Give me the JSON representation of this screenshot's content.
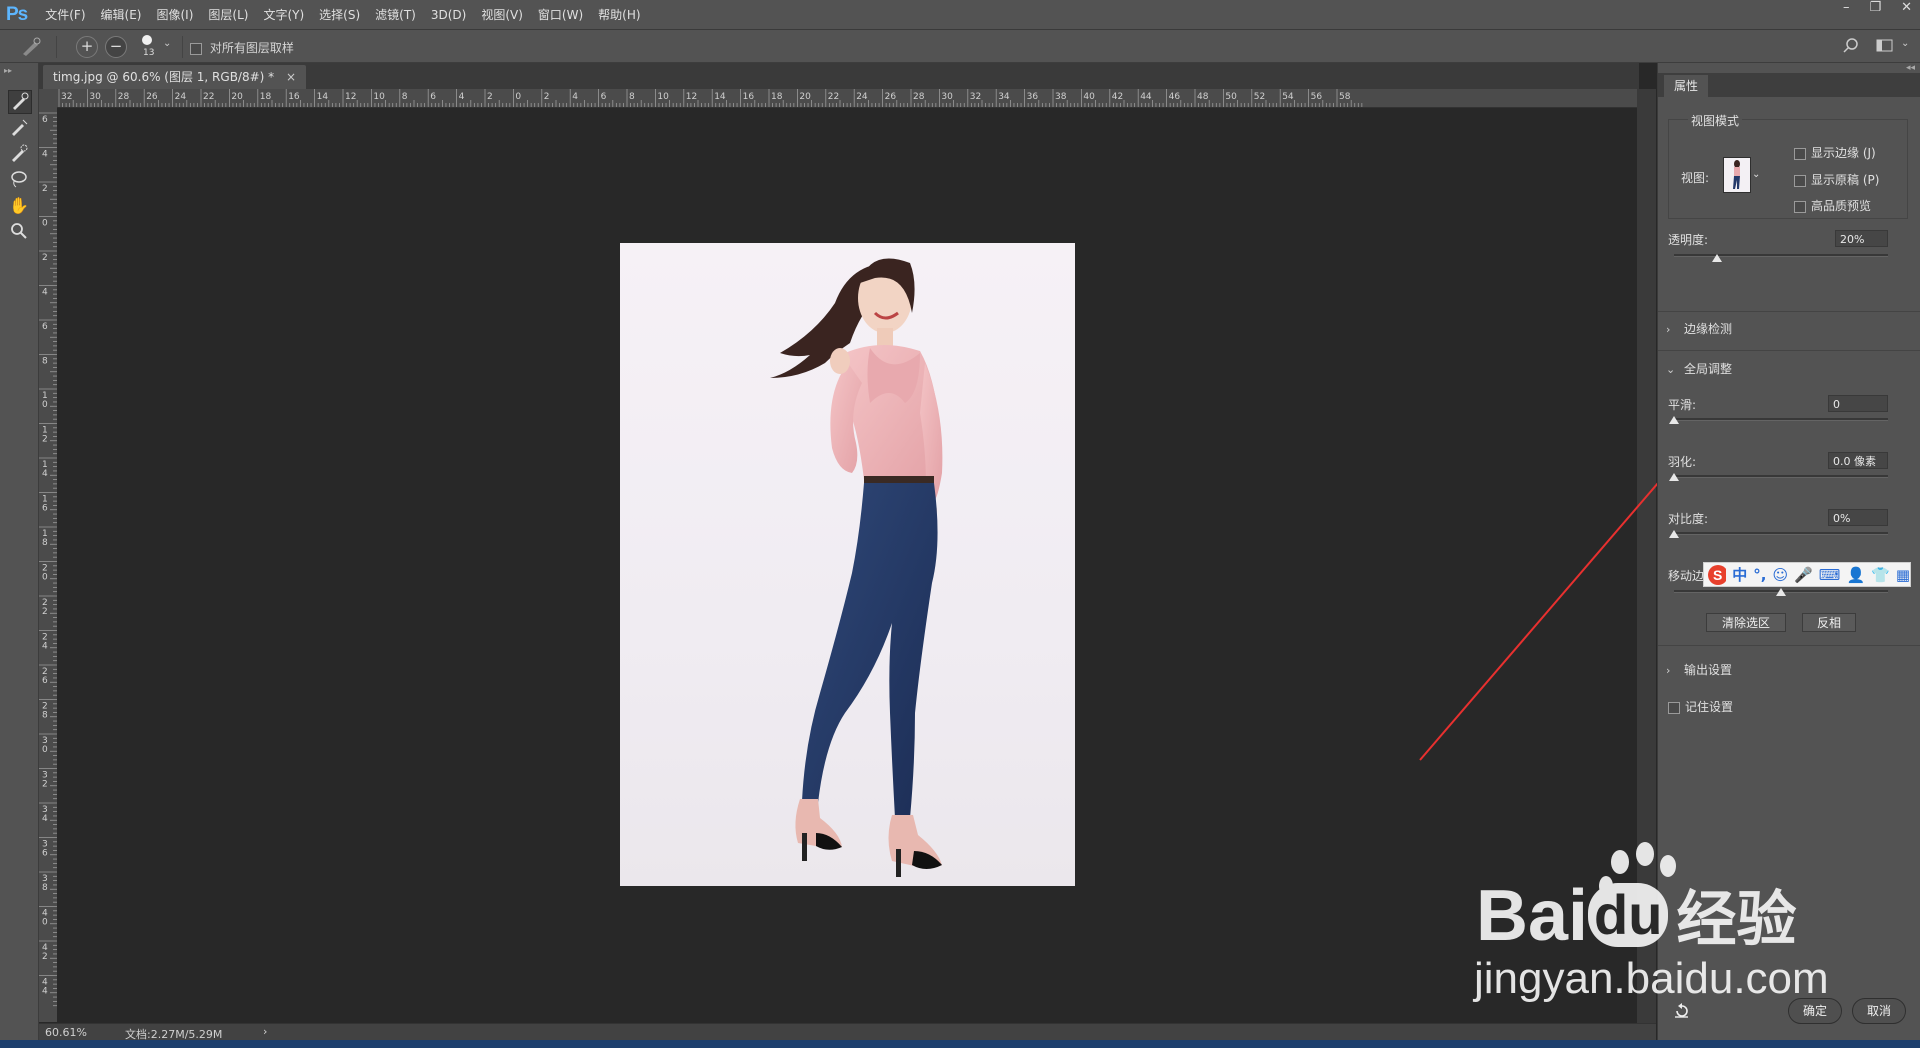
{
  "app": {
    "logo": "Ps"
  },
  "menu": [
    "文件(F)",
    "编辑(E)",
    "图像(I)",
    "图层(L)",
    "文字(Y)",
    "选择(S)",
    "滤镜(T)",
    "3D(D)",
    "视图(V)",
    "窗口(W)",
    "帮助(H)"
  ],
  "window_controls": [
    "–",
    "❐",
    "✕"
  ],
  "options": {
    "brush_size": "13",
    "sample_all_layers": "对所有图层取样"
  },
  "document": {
    "tab_title": "timg.jpg @ 60.6% (图层 1, RGB/8#) *",
    "close": "×"
  },
  "ruler": {
    "top_labels": [
      "32",
      "30",
      "28",
      "26",
      "24",
      "22",
      "20",
      "18",
      "16",
      "14",
      "12",
      "10",
      "8",
      "6",
      "4",
      "2",
      "0",
      "2",
      "4",
      "6",
      "8",
      "10",
      "12",
      "14",
      "16",
      "18",
      "20",
      "22",
      "24",
      "26",
      "28",
      "30",
      "32",
      "34",
      "36",
      "38",
      "40",
      "42",
      "44",
      "46",
      "48",
      "50",
      "52",
      "54",
      "56",
      "58"
    ],
    "left_labels": [
      "6",
      "4",
      "2",
      "0",
      "2",
      "4",
      "6",
      "8",
      "10",
      "12",
      "14",
      "16",
      "18",
      "20",
      "22",
      "24",
      "26",
      "28",
      "30",
      "32",
      "34",
      "36",
      "38",
      "40",
      "42",
      "44"
    ]
  },
  "status": {
    "zoom": "60.61%",
    "doc": "文档:2.27M/5.29M",
    "arrow": "›"
  },
  "panel": {
    "tab": "属性",
    "view_mode": {
      "title": "视图模式",
      "view_label": "视图:",
      "show_edge": "显示边缘 (J)",
      "show_original": "显示原稿 (P)",
      "hq_preview": "高品质预览"
    },
    "opacity": {
      "label": "透明度:",
      "value": "20%",
      "level": 0.2
    },
    "edge_detect": {
      "title": "边缘检测"
    },
    "global": {
      "title": "全局调整",
      "smooth": {
        "label": "平滑:",
        "value": "0",
        "level": 0.0
      },
      "feather": {
        "label": "羽化:",
        "value": "0.0 像素",
        "level": 0.0
      },
      "contrast": {
        "label": "对比度:",
        "value": "0%",
        "level": 0.0
      },
      "shift_edge": {
        "label": "移动边",
        "level": 0.5
      }
    },
    "clear_selection": "清除选区",
    "invert": "反相",
    "output": {
      "title": "输出设置"
    },
    "remember": "记住设置",
    "ok": "确定",
    "cancel": "取消"
  },
  "ime": {
    "items": [
      "中",
      "°,",
      "☺",
      "🎤",
      "⌨",
      "👤",
      "👕",
      "▦"
    ]
  },
  "watermark": {
    "brand_a": "Bai",
    "brand_b": "du",
    "brand_c": "经验",
    "url": "jingyan.baidu.com"
  },
  "colors": {
    "accent_blue": "#5db6ff",
    "arrow_red": "#e8302f",
    "canvas_bg": "#282828",
    "panel_bg": "#535353"
  }
}
